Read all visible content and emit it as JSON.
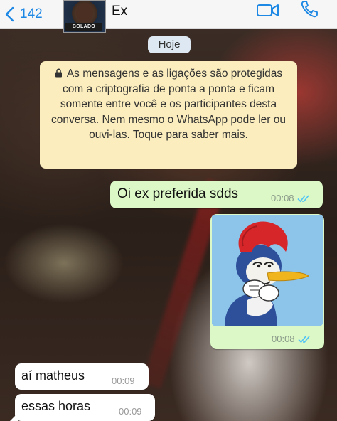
{
  "header": {
    "back_count": "142",
    "avatar_label": "BOLADO",
    "contact_name": "Ex"
  },
  "date_label": "Hoje",
  "notice": {
    "text": "As mensagens e as ligações são protegidas com a criptografia de ponta a ponta e ficam somente entre você e os participantes desta conversa. Nem mesmo o WhatsApp pode ler ou ouvi-las. Toque para saber mais."
  },
  "messages": [
    {
      "direction": "outgoing",
      "type": "text",
      "text": "Oi ex preferida sdds",
      "time": "00:08",
      "status": "read"
    },
    {
      "direction": "outgoing",
      "type": "image",
      "image": "woody-woodpecker-smirk",
      "time": "00:08",
      "status": "read"
    },
    {
      "direction": "incoming",
      "type": "text",
      "text": "aí matheus",
      "time": "00:09"
    },
    {
      "direction": "incoming",
      "type": "text",
      "text": "essas horas",
      "time": "00:09"
    }
  ],
  "colors": {
    "header_bg": "#f6f6f6",
    "accent_blue": "#1e88e5",
    "outgoing_bubble": "#dcf8c6",
    "incoming_bubble": "#ffffff",
    "notice_bg": "#fbedbd",
    "date_pill_bg": "#dde8f2",
    "read_ticks": "#4fc3f7"
  },
  "icons": [
    "chevron-left-icon",
    "video-call-icon",
    "phone-icon",
    "lock-icon",
    "double-check-icon"
  ]
}
